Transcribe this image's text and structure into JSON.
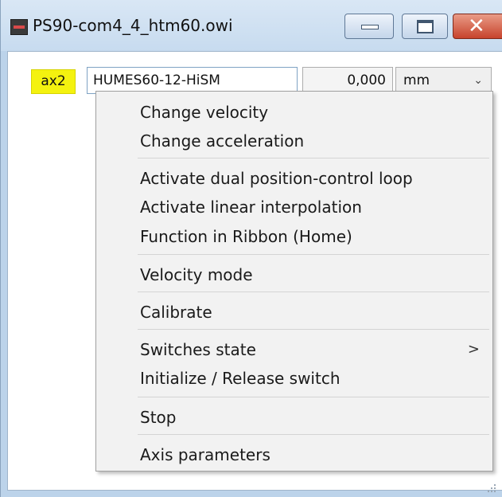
{
  "window": {
    "title": "PS90-com4_4_htm60.owi",
    "icon": "app-icon",
    "controls": {
      "minimize": "minimize-icon",
      "maximize": "maximize-icon",
      "close": "close-icon"
    }
  },
  "axis": {
    "label": "ax2",
    "device": "HUMES60-12-HiSM",
    "position": "0,000",
    "unit": "mm"
  },
  "context_menu": {
    "items": [
      "Change velocity",
      "Change acceleration",
      "Activate dual position-control loop",
      "Activate linear interpolation",
      "Function in Ribbon (Home)",
      "Velocity mode",
      "Calibrate",
      "Switches state",
      "Initialize / Release switch",
      "Stop",
      "Axis parameters"
    ],
    "submenu_arrow": ">"
  },
  "colors": {
    "axis_label_bg": "#f4f20f",
    "close_button": "#c7432c",
    "title_bar": "#c7dbef"
  }
}
